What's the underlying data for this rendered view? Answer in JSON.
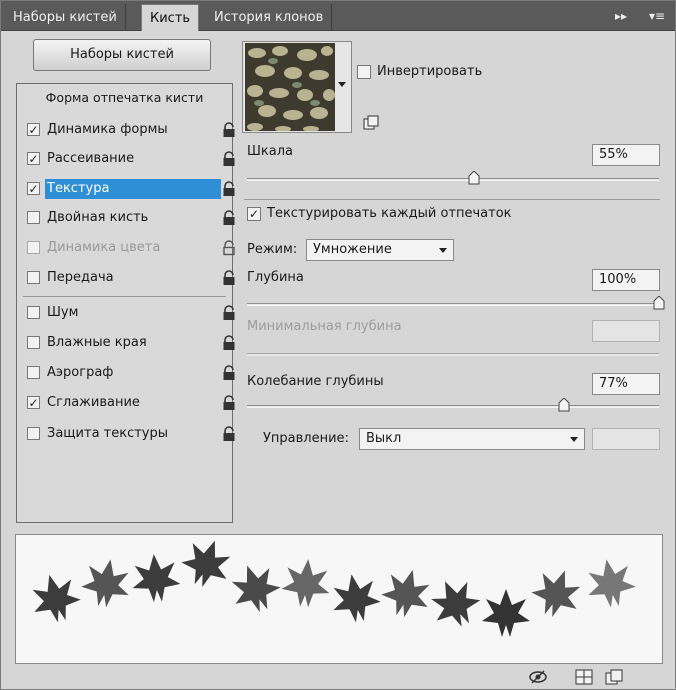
{
  "tabs": [
    {
      "label": "Наборы кистей"
    },
    {
      "label": "Кисть"
    },
    {
      "label": "История клонов"
    }
  ],
  "brush_presets_button": "Наборы кистей",
  "left_panel": {
    "heading": "Форма отпечатка кисти",
    "items": [
      {
        "label": "Динамика формы",
        "checked": true
      },
      {
        "label": "Рассеивание",
        "checked": true
      },
      {
        "label": "Текстура",
        "checked": true,
        "selected": true
      },
      {
        "label": "Двойная кисть",
        "checked": false
      },
      {
        "label": "Динамика цвета",
        "checked": false,
        "disabled": true
      },
      {
        "label": "Передача",
        "checked": false
      },
      {
        "label": "Шум",
        "checked": false
      },
      {
        "label": "Влажные края",
        "checked": false
      },
      {
        "label": "Аэрограф",
        "checked": false
      },
      {
        "label": "Сглаживание",
        "checked": true
      },
      {
        "label": "Защита текстуры",
        "checked": false
      }
    ]
  },
  "texture": {
    "invert_label": "Инвертировать",
    "invert_checked": false,
    "scale_label": "Шкала",
    "scale_value": "55%",
    "scale_fraction": 0.55,
    "texture_each_tip_label": "Текстурировать каждый отпечаток",
    "texture_each_tip_checked": true,
    "mode_label": "Режим:",
    "mode_value": "Умножение",
    "depth_label": "Глубина",
    "depth_value": "100%",
    "depth_fraction": 1.0,
    "min_depth_label": "Минимальная глубина",
    "depth_jitter_label": "Колебание глубины",
    "depth_jitter_value": "77%",
    "depth_jitter_fraction": 0.77,
    "control_label": "Управление:",
    "control_value": "Выкл"
  },
  "icons": {
    "panel_menu": "panel-menu-icon",
    "collapse": "double-chevron-icon",
    "lock": "lock-icon",
    "new_preset": "new-preset-icon",
    "eye": "eye-icon",
    "grid": "grid-icon",
    "create": "create-icon"
  }
}
